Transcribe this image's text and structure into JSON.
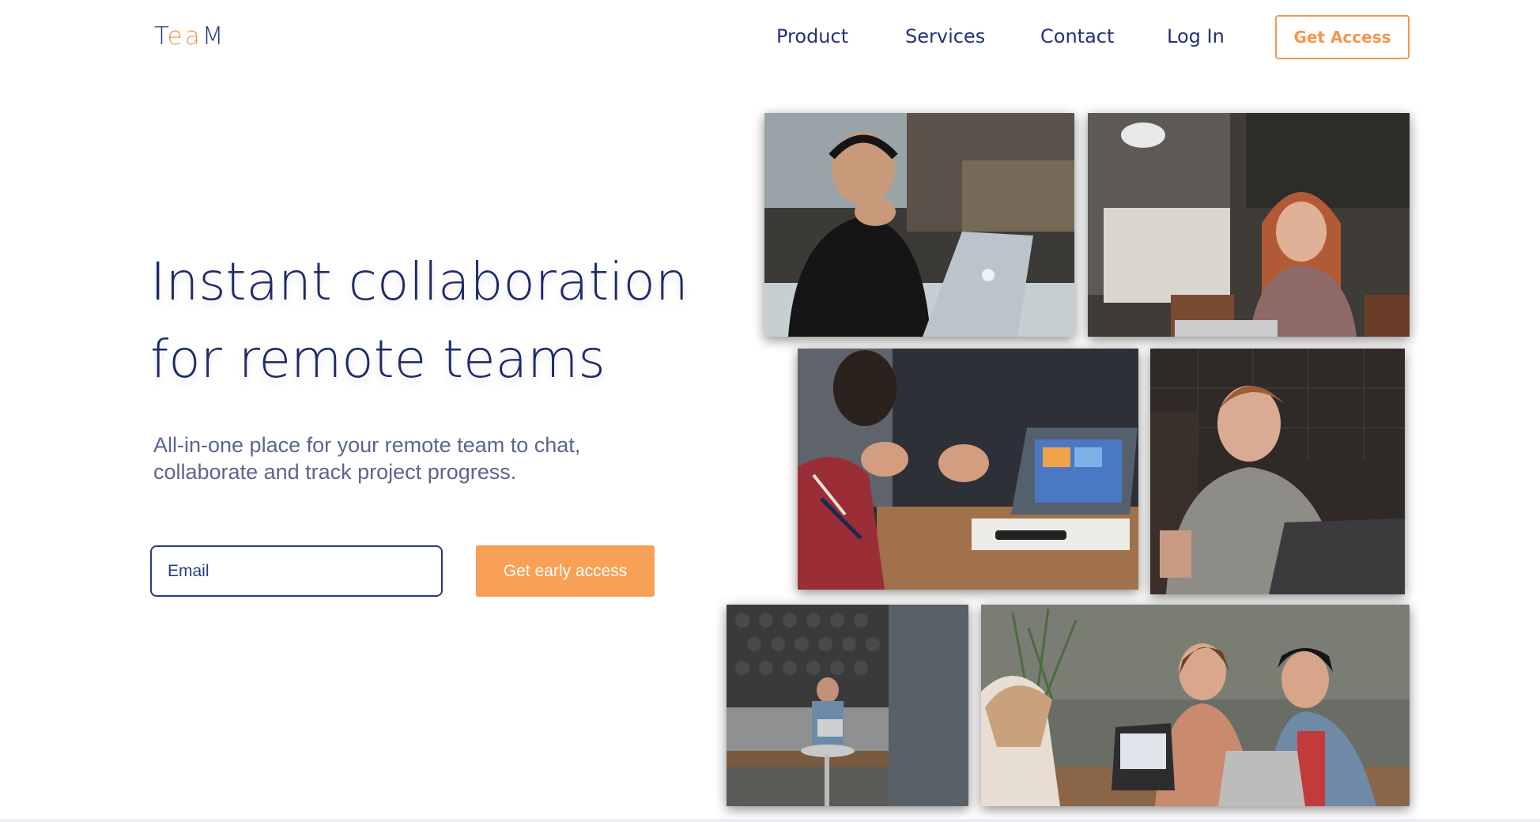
{
  "brand": {
    "logo_part1": "Tea",
    "logo_part2": "M",
    "accent_color": "#f5964b",
    "primary_color": "#1f2a6b"
  },
  "nav": {
    "items": [
      {
        "label": "Product"
      },
      {
        "label": "Services"
      },
      {
        "label": "Contact"
      },
      {
        "label": "Log In"
      }
    ],
    "cta_label": "Get Access"
  },
  "hero": {
    "title_line1": "Instant collaboration",
    "title_line2": "for remote teams",
    "subtitle_line1": "All-in-one place for your remote team to chat,",
    "subtitle_line2": "collaborate and track project progress.",
    "email_placeholder": "Email",
    "cta_label": "Get early access"
  }
}
